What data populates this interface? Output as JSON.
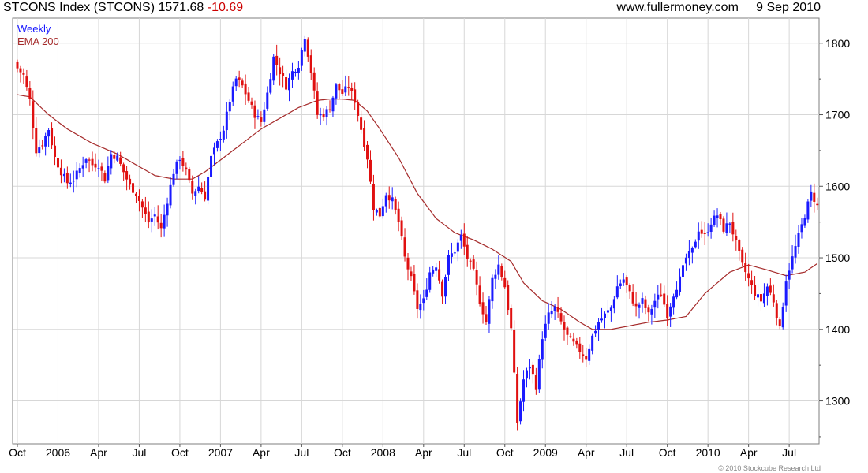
{
  "header": {
    "title": "STCONS Index (STCONS)",
    "last": "1571.68",
    "change": "-10.69",
    "site": "www.fullermoney.com",
    "date": "9 Sep 2010"
  },
  "copyright": "© 2010 Stockcube Research Ltd",
  "colors": {
    "up": "#1a1aff",
    "down": "#e01010",
    "ema": "#a52a2a",
    "grid": "#d7d7d7"
  },
  "chart_data": {
    "type": "candlestick",
    "ylim": [
      1240,
      1835
    ],
    "y_ticks": [
      1300,
      1400,
      1500,
      1600,
      1700,
      1800
    ],
    "x_tick_labels": [
      {
        "label": "Oct",
        "week": 0
      },
      {
        "label": "2006",
        "week": 13
      },
      {
        "label": "Apr",
        "week": 26
      },
      {
        "label": "Jul",
        "week": 39
      },
      {
        "label": "Oct",
        "week": 52
      },
      {
        "label": "2007",
        "week": 65
      },
      {
        "label": "Apr",
        "week": 78
      },
      {
        "label": "Jul",
        "week": 91
      },
      {
        "label": "Oct",
        "week": 104
      },
      {
        "label": "2008",
        "week": 117
      },
      {
        "label": "Apr",
        "week": 130
      },
      {
        "label": "Jul",
        "week": 143
      },
      {
        "label": "Oct",
        "week": 156
      },
      {
        "label": "2009",
        "week": 169
      },
      {
        "label": "Apr",
        "week": 182
      },
      {
        "label": "Jul",
        "week": 195
      },
      {
        "label": "Oct",
        "week": 208
      },
      {
        "label": "2010",
        "week": 221
      },
      {
        "label": "Apr",
        "week": 234
      },
      {
        "label": "Jul",
        "week": 247
      }
    ],
    "weeks": 257,
    "legend": [
      "Weekly",
      "EMA 200"
    ],
    "series": [
      {
        "name": "Weekly",
        "type": "candlestick",
        "close_anchors": [
          [
            0,
            1765
          ],
          [
            2,
            1755
          ],
          [
            4,
            1720
          ],
          [
            6,
            1650
          ],
          [
            8,
            1660
          ],
          [
            10,
            1680
          ],
          [
            12,
            1640
          ],
          [
            14,
            1620
          ],
          [
            16,
            1605
          ],
          [
            18,
            1610
          ],
          [
            20,
            1625
          ],
          [
            22,
            1640
          ],
          [
            24,
            1630
          ],
          [
            26,
            1630
          ],
          [
            28,
            1610
          ],
          [
            30,
            1645
          ],
          [
            32,
            1640
          ],
          [
            34,
            1620
          ],
          [
            36,
            1600
          ],
          [
            38,
            1590
          ],
          [
            40,
            1570
          ],
          [
            42,
            1550
          ],
          [
            44,
            1560
          ],
          [
            46,
            1540
          ],
          [
            48,
            1580
          ],
          [
            50,
            1620
          ],
          [
            52,
            1640
          ],
          [
            54,
            1620
          ],
          [
            56,
            1590
          ],
          [
            58,
            1600
          ],
          [
            60,
            1585
          ],
          [
            62,
            1640
          ],
          [
            64,
            1660
          ],
          [
            66,
            1680
          ],
          [
            68,
            1720
          ],
          [
            70,
            1750
          ],
          [
            72,
            1740
          ],
          [
            74,
            1720
          ],
          [
            76,
            1700
          ],
          [
            78,
            1690
          ],
          [
            80,
            1730
          ],
          [
            82,
            1780
          ],
          [
            84,
            1760
          ],
          [
            86,
            1740
          ],
          [
            88,
            1760
          ],
          [
            90,
            1770
          ],
          [
            92,
            1810
          ],
          [
            94,
            1760
          ],
          [
            96,
            1700
          ],
          [
            98,
            1700
          ],
          [
            100,
            1710
          ],
          [
            102,
            1740
          ],
          [
            104,
            1730
          ],
          [
            106,
            1740
          ],
          [
            108,
            1720
          ],
          [
            110,
            1680
          ],
          [
            112,
            1640
          ],
          [
            114,
            1570
          ],
          [
            116,
            1560
          ],
          [
            118,
            1590
          ],
          [
            120,
            1580
          ],
          [
            122,
            1550
          ],
          [
            124,
            1500
          ],
          [
            126,
            1470
          ],
          [
            128,
            1430
          ],
          [
            130,
            1440
          ],
          [
            132,
            1480
          ],
          [
            134,
            1490
          ],
          [
            136,
            1450
          ],
          [
            138,
            1500
          ],
          [
            140,
            1510
          ],
          [
            142,
            1530
          ],
          [
            144,
            1500
          ],
          [
            146,
            1480
          ],
          [
            148,
            1440
          ],
          [
            150,
            1410
          ],
          [
            152,
            1470
          ],
          [
            154,
            1490
          ],
          [
            156,
            1460
          ],
          [
            158,
            1400
          ],
          [
            160,
            1270
          ],
          [
            162,
            1330
          ],
          [
            164,
            1350
          ],
          [
            166,
            1320
          ],
          [
            168,
            1390
          ],
          [
            170,
            1420
          ],
          [
            172,
            1430
          ],
          [
            174,
            1410
          ],
          [
            176,
            1390
          ],
          [
            178,
            1380
          ],
          [
            180,
            1370
          ],
          [
            182,
            1360
          ],
          [
            184,
            1390
          ],
          [
            186,
            1410
          ],
          [
            188,
            1420
          ],
          [
            190,
            1430
          ],
          [
            192,
            1460
          ],
          [
            194,
            1470
          ],
          [
            196,
            1450
          ],
          [
            198,
            1430
          ],
          [
            200,
            1440
          ],
          [
            202,
            1420
          ],
          [
            204,
            1440
          ],
          [
            206,
            1450
          ],
          [
            208,
            1420
          ],
          [
            210,
            1450
          ],
          [
            212,
            1470
          ],
          [
            214,
            1500
          ],
          [
            216,
            1510
          ],
          [
            218,
            1540
          ],
          [
            220,
            1530
          ],
          [
            222,
            1550
          ],
          [
            224,
            1560
          ],
          [
            226,
            1540
          ],
          [
            228,
            1550
          ],
          [
            230,
            1520
          ],
          [
            232,
            1490
          ],
          [
            234,
            1470
          ],
          [
            236,
            1450
          ],
          [
            238,
            1440
          ],
          [
            240,
            1460
          ],
          [
            242,
            1440
          ],
          [
            244,
            1400
          ],
          [
            246,
            1470
          ],
          [
            248,
            1500
          ],
          [
            250,
            1530
          ],
          [
            252,
            1560
          ],
          [
            254,
            1590
          ],
          [
            255,
            1582
          ],
          [
            256,
            1572
          ]
        ]
      },
      {
        "name": "EMA 200",
        "type": "line",
        "points": [
          [
            0,
            1728
          ],
          [
            4,
            1725
          ],
          [
            10,
            1700
          ],
          [
            16,
            1680
          ],
          [
            24,
            1660
          ],
          [
            32,
            1645
          ],
          [
            38,
            1630
          ],
          [
            44,
            1615
          ],
          [
            50,
            1610
          ],
          [
            56,
            1610
          ],
          [
            60,
            1620
          ],
          [
            66,
            1640
          ],
          [
            72,
            1660
          ],
          [
            78,
            1680
          ],
          [
            84,
            1695
          ],
          [
            90,
            1710
          ],
          [
            96,
            1720
          ],
          [
            100,
            1722
          ],
          [
            104,
            1722
          ],
          [
            108,
            1720
          ],
          [
            112,
            1705
          ],
          [
            116,
            1680
          ],
          [
            122,
            1640
          ],
          [
            128,
            1590
          ],
          [
            134,
            1555
          ],
          [
            140,
            1535
          ],
          [
            146,
            1525
          ],
          [
            152,
            1512
          ],
          [
            158,
            1495
          ],
          [
            162,
            1465
          ],
          [
            168,
            1440
          ],
          [
            174,
            1428
          ],
          [
            180,
            1410
          ],
          [
            184,
            1400
          ],
          [
            190,
            1400
          ],
          [
            196,
            1405
          ],
          [
            202,
            1410
          ],
          [
            208,
            1413
          ],
          [
            214,
            1418
          ],
          [
            220,
            1450
          ],
          [
            228,
            1480
          ],
          [
            234,
            1490
          ],
          [
            240,
            1483
          ],
          [
            246,
            1475
          ],
          [
            252,
            1480
          ],
          [
            256,
            1492
          ]
        ]
      }
    ]
  }
}
